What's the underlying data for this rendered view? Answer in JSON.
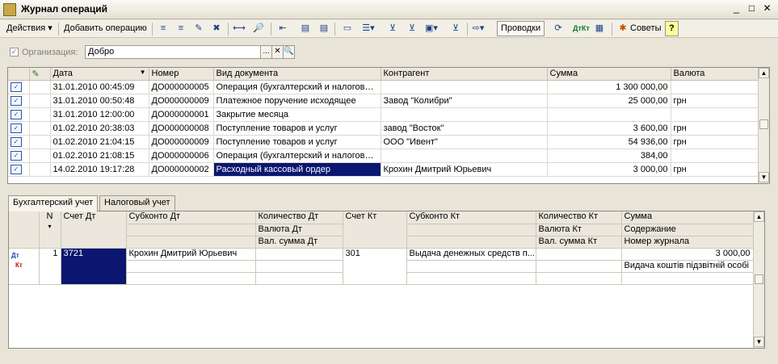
{
  "window": {
    "title": "Журнал операций",
    "minimize": "_",
    "maximize": "□",
    "close": "✕"
  },
  "toolbar": {
    "actions": "Действия ▾",
    "add_operation": "Добавить операцию",
    "postings": "Проводки",
    "tips": "Советы",
    "help": "?"
  },
  "filter": {
    "org_label": "Организация:",
    "org_value": "Добро",
    "btn_select": "...",
    "btn_clear": "✕",
    "btn_open": "🔍"
  },
  "journal": {
    "columns": [
      "",
      "Дата",
      "Номер",
      "Вид документа",
      "Контрагент",
      "Сумма",
      "Валюта"
    ],
    "rows": [
      {
        "date": "31.01.2010 00:45:09",
        "number": "ДО000000005",
        "type": "Операция (бухгалтерский и налоговы...",
        "counterparty": "",
        "sum": "1 300 000,00",
        "currency": ""
      },
      {
        "date": "31.01.2010 00:50:48",
        "number": "ДО000000009",
        "type": "Платежное поручение исходящее",
        "counterparty": "Завод \"Колибри\"",
        "sum": "25 000,00",
        "currency": "грн"
      },
      {
        "date": "31.01.2010 12:00:00",
        "number": "ДО000000001",
        "type": "Закрытие месяца",
        "counterparty": "",
        "sum": "",
        "currency": ""
      },
      {
        "date": "01.02.2010 20:38:03",
        "number": "ДО000000008",
        "type": "Поступление товаров и услуг",
        "counterparty": "завод \"Восток\"",
        "sum": "3 600,00",
        "currency": "грн"
      },
      {
        "date": "01.02.2010 21:04:15",
        "number": "ДО000000009",
        "type": "Поступление товаров и услуг",
        "counterparty": "ООО \"Ивент\"",
        "sum": "54 936,00",
        "currency": "грн"
      },
      {
        "date": "01.02.2010 21:08:15",
        "number": "ДО000000006",
        "type": "Операция (бухгалтерский и налоговы...",
        "counterparty": "",
        "sum": "384,00",
        "currency": ""
      },
      {
        "date": "14.02.2010 19:17:28",
        "number": "ДО000000002",
        "type": "Расходный кассовый ордер",
        "counterparty": "Крохин Дмитрий Юрьевич",
        "sum": "3 000,00",
        "currency": "грн"
      }
    ]
  },
  "tabs": {
    "accounting": "Бухгалтерский учет",
    "tax": "Налоговый учет"
  },
  "postings": {
    "headers": {
      "n": "N",
      "sort": "▾",
      "account_dt": "Счет Дт",
      "subconto_dt": "Субконто Дт",
      "qty_dt": "Количество Дт",
      "currency_dt": "Валюта Дт",
      "cur_sum_dt": "Вал. сумма Дт",
      "account_kt": "Счет Кт",
      "subconto_kt": "Субконто Кт",
      "qty_kt": "Количество Кт",
      "currency_kt": "Валюта Кт",
      "cur_sum_kt": "Вал. сумма Кт",
      "sum": "Сумма",
      "content": "Содержание",
      "journal_no": "Номер журнала"
    },
    "row": {
      "dt_label": "Дт",
      "kt_label": "Кт",
      "n": "1",
      "account_dt": "3721",
      "subconto_dt": "Крохин Дмитрий Юрьевич",
      "account_kt": "301",
      "subconto_kt": "Выдача денежных средств п...",
      "sum": "3 000,00",
      "content": "Видача коштів підзвітній особі"
    }
  },
  "scroll": {
    "up": "▲",
    "down": "▼"
  }
}
